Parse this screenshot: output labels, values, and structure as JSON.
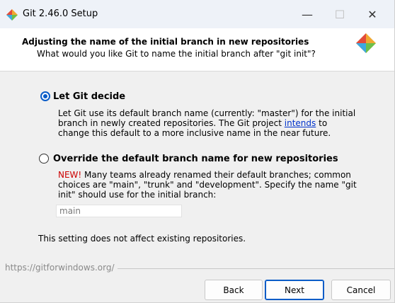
{
  "window": {
    "title": "Git 2.46.0 Setup",
    "icon": "git-logo-icon",
    "controls": {
      "minimize": "—",
      "maximize": "☐",
      "close": "✕"
    }
  },
  "header": {
    "heading": "Adjusting the name of the initial branch in new repositories",
    "subheading": "What would you like Git to name the initial branch after \"git init\"?"
  },
  "options": {
    "let_git_decide": {
      "label": "Let Git decide",
      "selected": true,
      "desc_before_link": "Let Git use its default branch name (currently: \"master\") for the initial branch in newly created repositories. The Git project ",
      "link_text": "intends",
      "desc_after_link": " to change this default to a more inclusive name in the near future."
    },
    "override": {
      "label": "Override the default branch name for new repositories",
      "selected": false,
      "new_badge": "NEW!",
      "desc": " Many teams already renamed their default branches; common choices are \"main\", \"trunk\" and \"development\". Specify the name \"git init\" should use for the initial branch:",
      "input_value": "main"
    }
  },
  "note": "This setting does not affect existing repositories.",
  "footer": {
    "url": "https://gitforwindows.org/",
    "back_label": "Back",
    "next_label": "Next",
    "cancel_label": "Cancel"
  },
  "colors": {
    "accent": "#0a5cc7",
    "new_red": "#cc0000",
    "link": "#0033cc"
  }
}
